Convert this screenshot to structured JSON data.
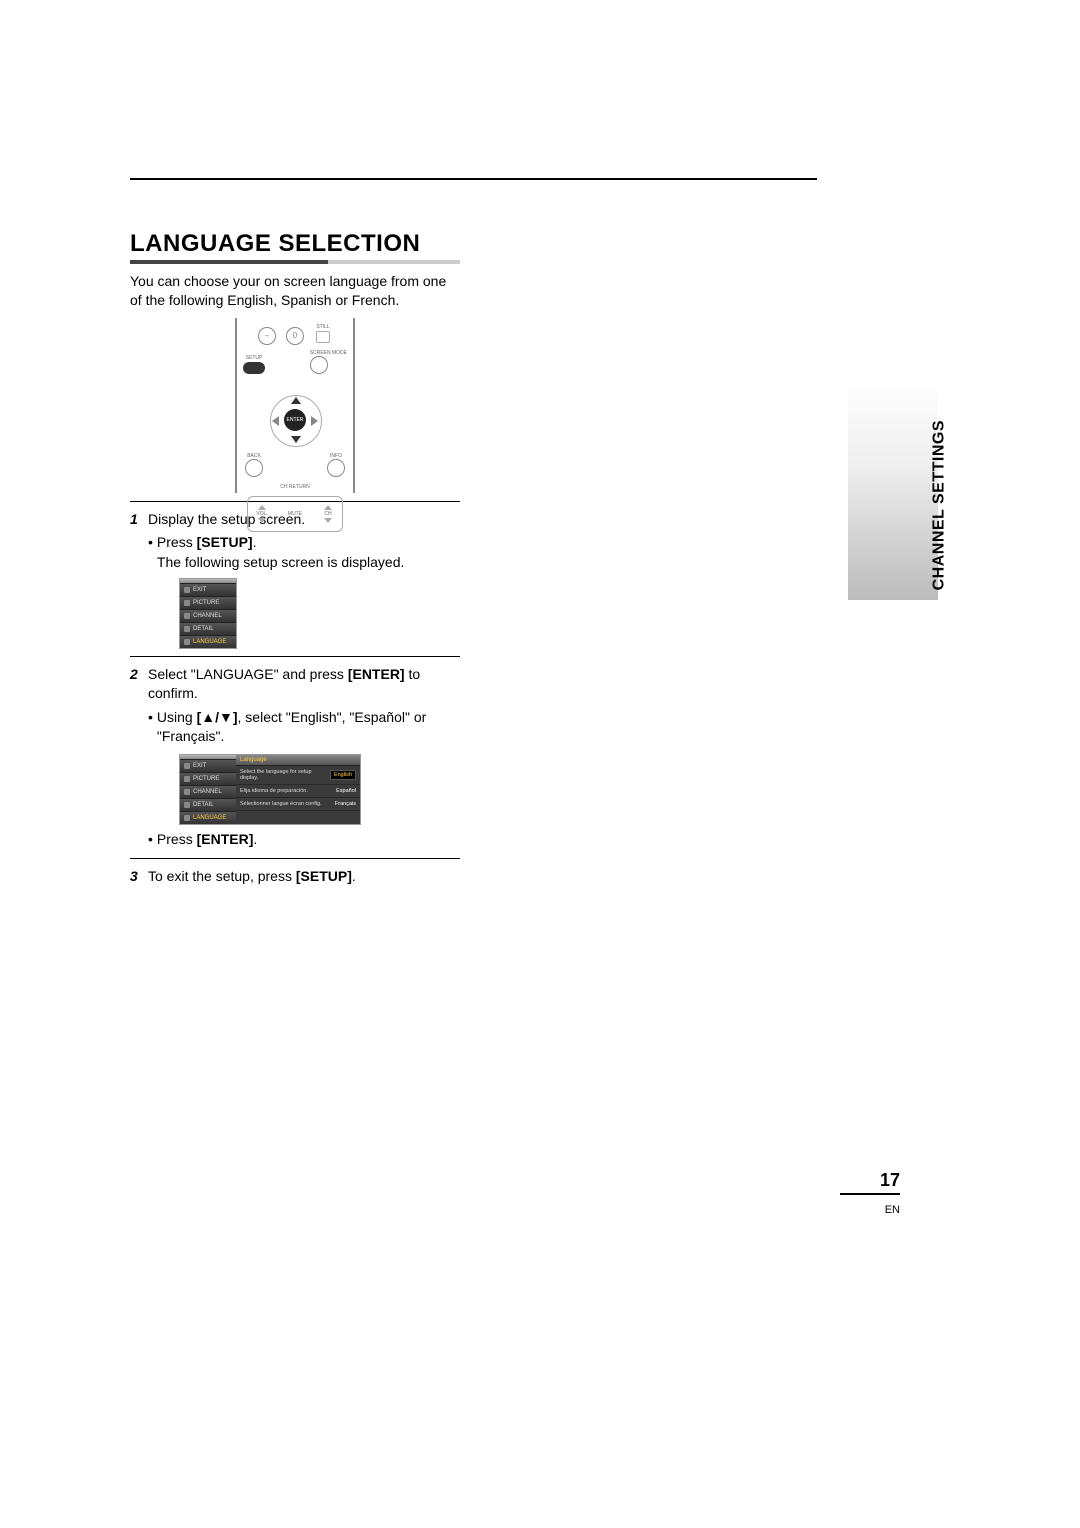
{
  "section_label": "CHANNEL SETTINGS",
  "heading": "LANGUAGE SELECTION",
  "intro": "You can choose your on screen language from one of the following English, Spanish or French.",
  "remote": {
    "still": "STILL",
    "zero": "0",
    "screen_mode": "SCREEN MODE",
    "setup": "SETUP",
    "enter": "ENTER",
    "back": "BACK",
    "info": "INFO",
    "return": "CH RETURN",
    "vol": "VOL.",
    "ch": "CH",
    "mute": "MUTE"
  },
  "step1": {
    "num": "1",
    "text": "Display the setup screen.",
    "bullet_prefix": "Press ",
    "bullet_bold": "[SETUP]",
    "bullet_suffix": ".",
    "after": "The following setup screen is displayed."
  },
  "menu1_items": [
    {
      "label": "EXIT",
      "sel": false
    },
    {
      "label": "PICTURE",
      "sel": false
    },
    {
      "label": "CHANNEL",
      "sel": false
    },
    {
      "label": "DETAIL",
      "sel": false
    },
    {
      "label": "LANGUAGE",
      "sel": true
    }
  ],
  "step2": {
    "num": "2",
    "text_a": "Select \"LANGUAGE\" and press ",
    "text_b": "[ENTER]",
    "text_c": " to confirm.",
    "bullet_a": "Using ",
    "bullet_b": "[▲/▼]",
    "bullet_c": ", select \"English\", \"Español\" or \"Français\"."
  },
  "menu2": {
    "left": [
      {
        "label": "EXIT",
        "sel": false
      },
      {
        "label": "PICTURE",
        "sel": false
      },
      {
        "label": "CHANNEL",
        "sel": false
      },
      {
        "label": "DETAIL",
        "sel": false
      },
      {
        "label": "LANGUAGE",
        "sel": true
      }
    ],
    "title": "Language",
    "rows": [
      {
        "label": "Select the language for setup display.",
        "value": "English",
        "hl": true
      },
      {
        "label": "Elija idioma de preparación.",
        "value": "Español",
        "hl": false
      },
      {
        "label": "Sélectionner langue écran config.",
        "value": "Français",
        "hl": false
      }
    ]
  },
  "step2b": {
    "bullet_prefix": "Press ",
    "bullet_bold": "[ENTER]",
    "bullet_suffix": "."
  },
  "step3": {
    "num": "3",
    "text_a": "To exit the setup, press ",
    "text_b": "[SETUP]",
    "text_c": "."
  },
  "page_number": "17",
  "page_lang": "EN"
}
